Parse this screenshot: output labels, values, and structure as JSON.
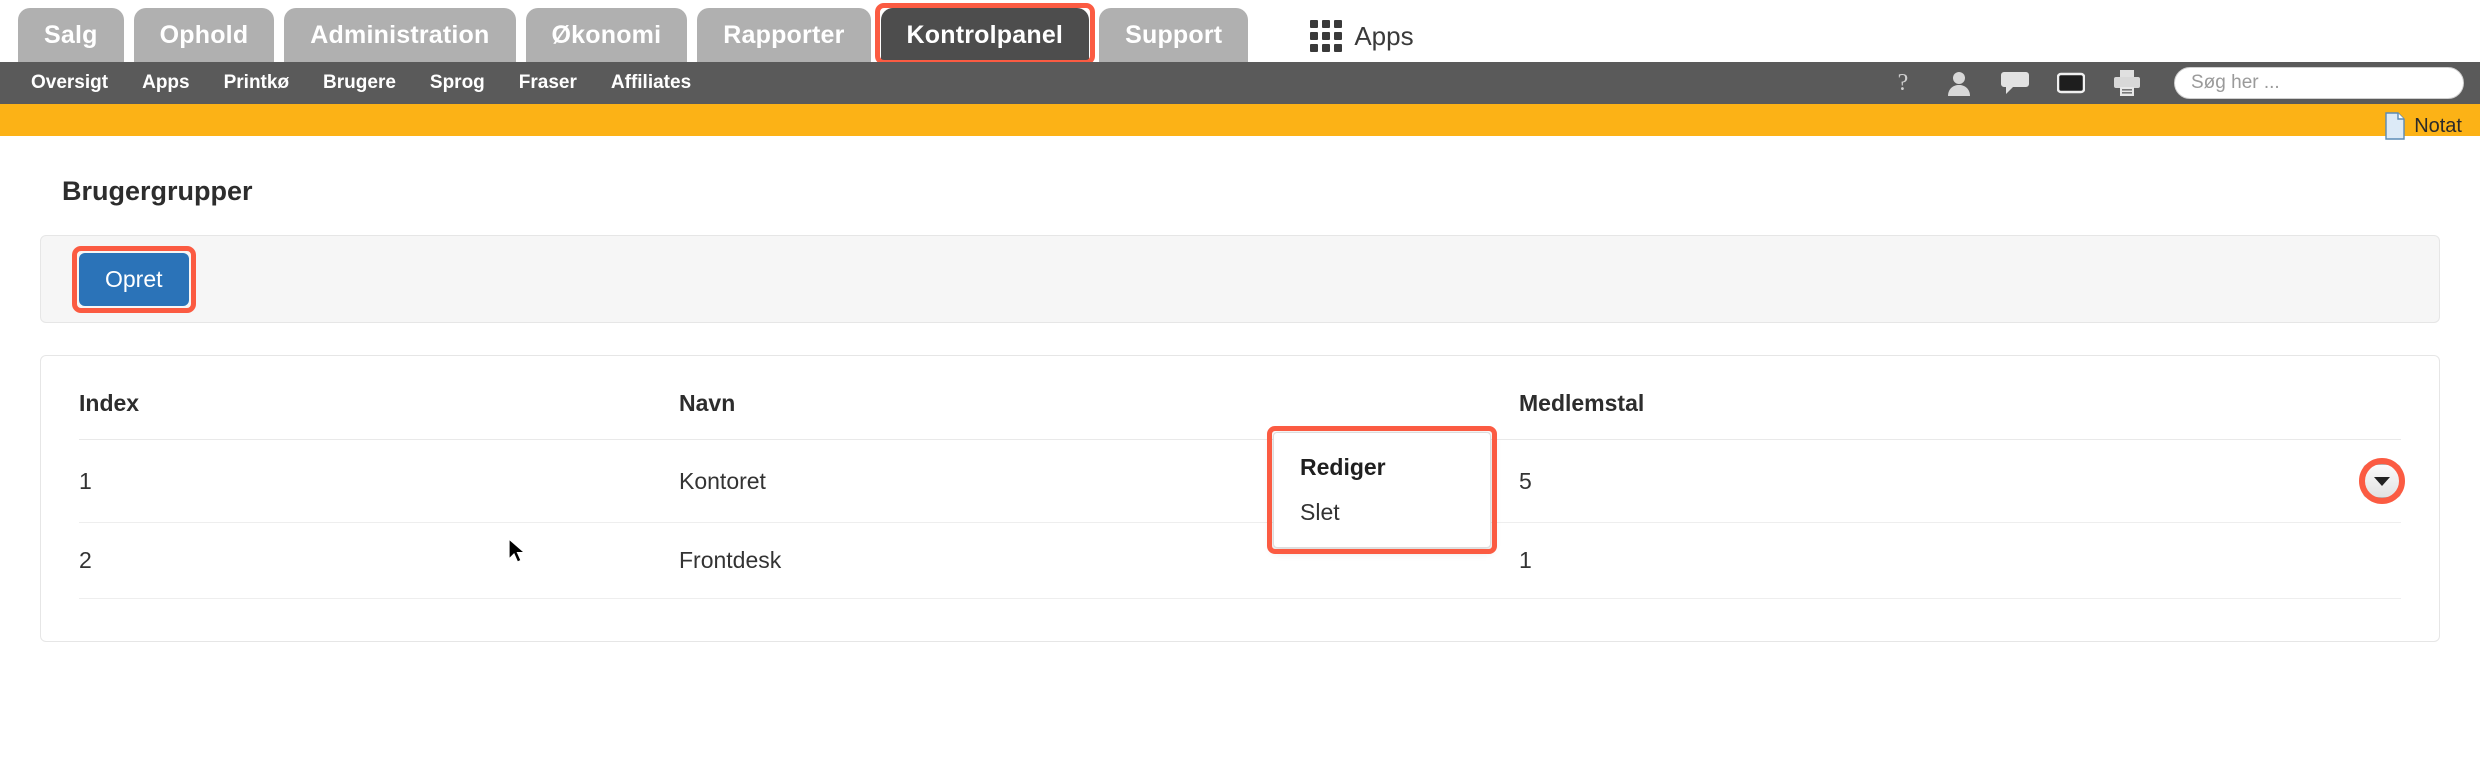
{
  "colors": {
    "tab_inactive_bg": "#b0b0b0",
    "tab_active_bg": "#4d4d4d",
    "subnav_bg": "#5a5a5a",
    "accent_orange": "#fcb216",
    "primary_button": "#2b73b8",
    "annotation_red": "#fb5b42"
  },
  "topnav": {
    "tabs": [
      {
        "label": "Salg",
        "active": false,
        "annotated": false
      },
      {
        "label": "Ophold",
        "active": false,
        "annotated": false
      },
      {
        "label": "Administration",
        "active": false,
        "annotated": false
      },
      {
        "label": "Økonomi",
        "active": false,
        "annotated": false
      },
      {
        "label": "Rapporter",
        "active": false,
        "annotated": false
      },
      {
        "label": "Kontrolpanel",
        "active": true,
        "annotated": true
      },
      {
        "label": "Support",
        "active": false,
        "annotated": false
      }
    ],
    "apps_label": "Apps",
    "apps_icon": "grid-apps-icon"
  },
  "subnav": {
    "items": [
      {
        "label": "Oversigt"
      },
      {
        "label": "Apps"
      },
      {
        "label": "Printkø"
      },
      {
        "label": "Brugere"
      },
      {
        "label": "Sprog"
      },
      {
        "label": "Fraser"
      },
      {
        "label": "Affiliates"
      }
    ],
    "icons": [
      {
        "name": "help-icon"
      },
      {
        "name": "user-icon"
      },
      {
        "name": "chat-bubble-icon"
      },
      {
        "name": "monitor-icon"
      },
      {
        "name": "printer-icon"
      }
    ],
    "search": {
      "placeholder": "Søg her ...",
      "value": ""
    }
  },
  "orangebar": {
    "notat_label": "Notat",
    "notat_icon": "document-icon"
  },
  "main": {
    "page_title": "Brugergrupper",
    "toolbar": {
      "create_label": "Opret"
    },
    "table": {
      "columns": [
        "Index",
        "Navn",
        "Medlemstal",
        ""
      ],
      "rows": [
        {
          "index": "1",
          "navn": "Kontoret",
          "medlemstal": "5"
        },
        {
          "index": "2",
          "navn": "Frontdesk",
          "medlemstal": "1"
        }
      ]
    },
    "dropdown": {
      "items": [
        {
          "label": "Rediger",
          "highlight": true
        },
        {
          "label": "Slet",
          "highlight": false
        }
      ]
    }
  }
}
